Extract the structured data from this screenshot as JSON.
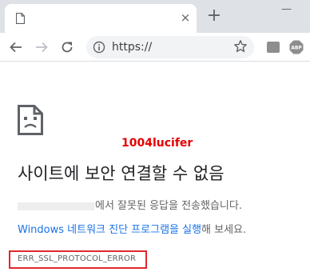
{
  "browser": {
    "tab_title": "",
    "tab_close": "×",
    "new_tab": "+",
    "window_minimize": "—",
    "url": "https://"
  },
  "icons": {
    "tab": "document-icon",
    "back": "back-arrow-icon",
    "forward": "forward-arrow-icon",
    "reload": "reload-icon",
    "info": "info-icon",
    "star": "star-icon",
    "extension_1": "extension-icon",
    "extension_2": "adblock-icon",
    "error": "sad-page-icon"
  },
  "watermark": "1004lucifer",
  "error_page": {
    "heading": "사이트에 보안 연결할 수 없음",
    "description_suffix": "에서 잘못된 응답을 전송했습니다.",
    "suggestion_link": "Windows 네트워크 진단 프로그램을 실행",
    "suggestion_suffix": "해 보세요.",
    "error_code": "ERR_SSL_PROTOCOL_ERROR"
  },
  "colors": {
    "link": "#1a73e8",
    "highlight": "#e0282e",
    "watermark": "#e60000",
    "tabstrip": "#dee1e6"
  }
}
